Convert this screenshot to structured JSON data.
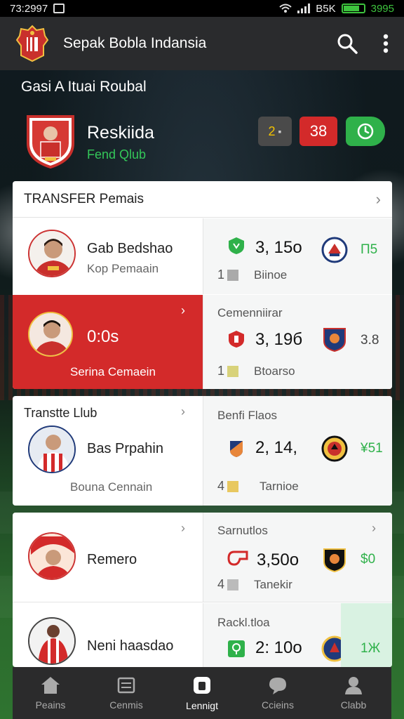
{
  "status": {
    "time": "73:2997",
    "network": "B5K",
    "battery": "3995"
  },
  "appbar": {
    "title": "Sepak Bobla Indansia",
    "icons": [
      "search-icon",
      "more-vert-icon"
    ]
  },
  "header": {
    "section_title": "Gasi A Ituai Roubal",
    "club_name": "Reskiida",
    "club_sub": "Fend Qlub",
    "chip_a": "2",
    "chip_b": "38"
  },
  "card1": {
    "title": "TRANSFER Pemais",
    "rows": [
      {
        "name": "Gab Bedshao",
        "sub": "Kop Pemaain",
        "price": "3, 15o",
        "rank": "1",
        "rank_label": "Biinoe",
        "delta": "П5"
      },
      {
        "score": "0:0s",
        "sub": "Serina Cemaein",
        "label": "Cemenniirar",
        "price": "3, 19б",
        "rank": "1",
        "rank_label": "Btoarso",
        "delta": "3.8"
      }
    ]
  },
  "card2": {
    "title": "Transtte Llub",
    "name": "Bas Prpahin",
    "sub": "Bouna Cennain",
    "label": "Benfi Flaos",
    "price": "2, 14,",
    "rank": "4",
    "rank_label": "Tarnioe",
    "delta": "¥51"
  },
  "card3": {
    "rows": [
      {
        "name": "Remero",
        "label": "Sarnutlos",
        "price": "3,50o",
        "rank": "4",
        "rank_label": "Tanekir",
        "delta": "$0"
      },
      {
        "name": "Neni haasdao",
        "label": "Rackl.tloa",
        "price": "2: 10o",
        "delta": "1Ж"
      }
    ]
  },
  "nav": [
    {
      "label": "Peains",
      "icon": "home-icon"
    },
    {
      "label": "Cenmis",
      "icon": "list-icon"
    },
    {
      "label": "Lennigt",
      "icon": "shirt-icon"
    },
    {
      "label": "Ccieins",
      "icon": "chat-icon"
    },
    {
      "label": "Clabb",
      "icon": "profile-icon"
    }
  ],
  "colors": {
    "appbar": "#2a2b2d",
    "accent_red": "#d32a2a",
    "accent_green": "#2fb14a"
  }
}
